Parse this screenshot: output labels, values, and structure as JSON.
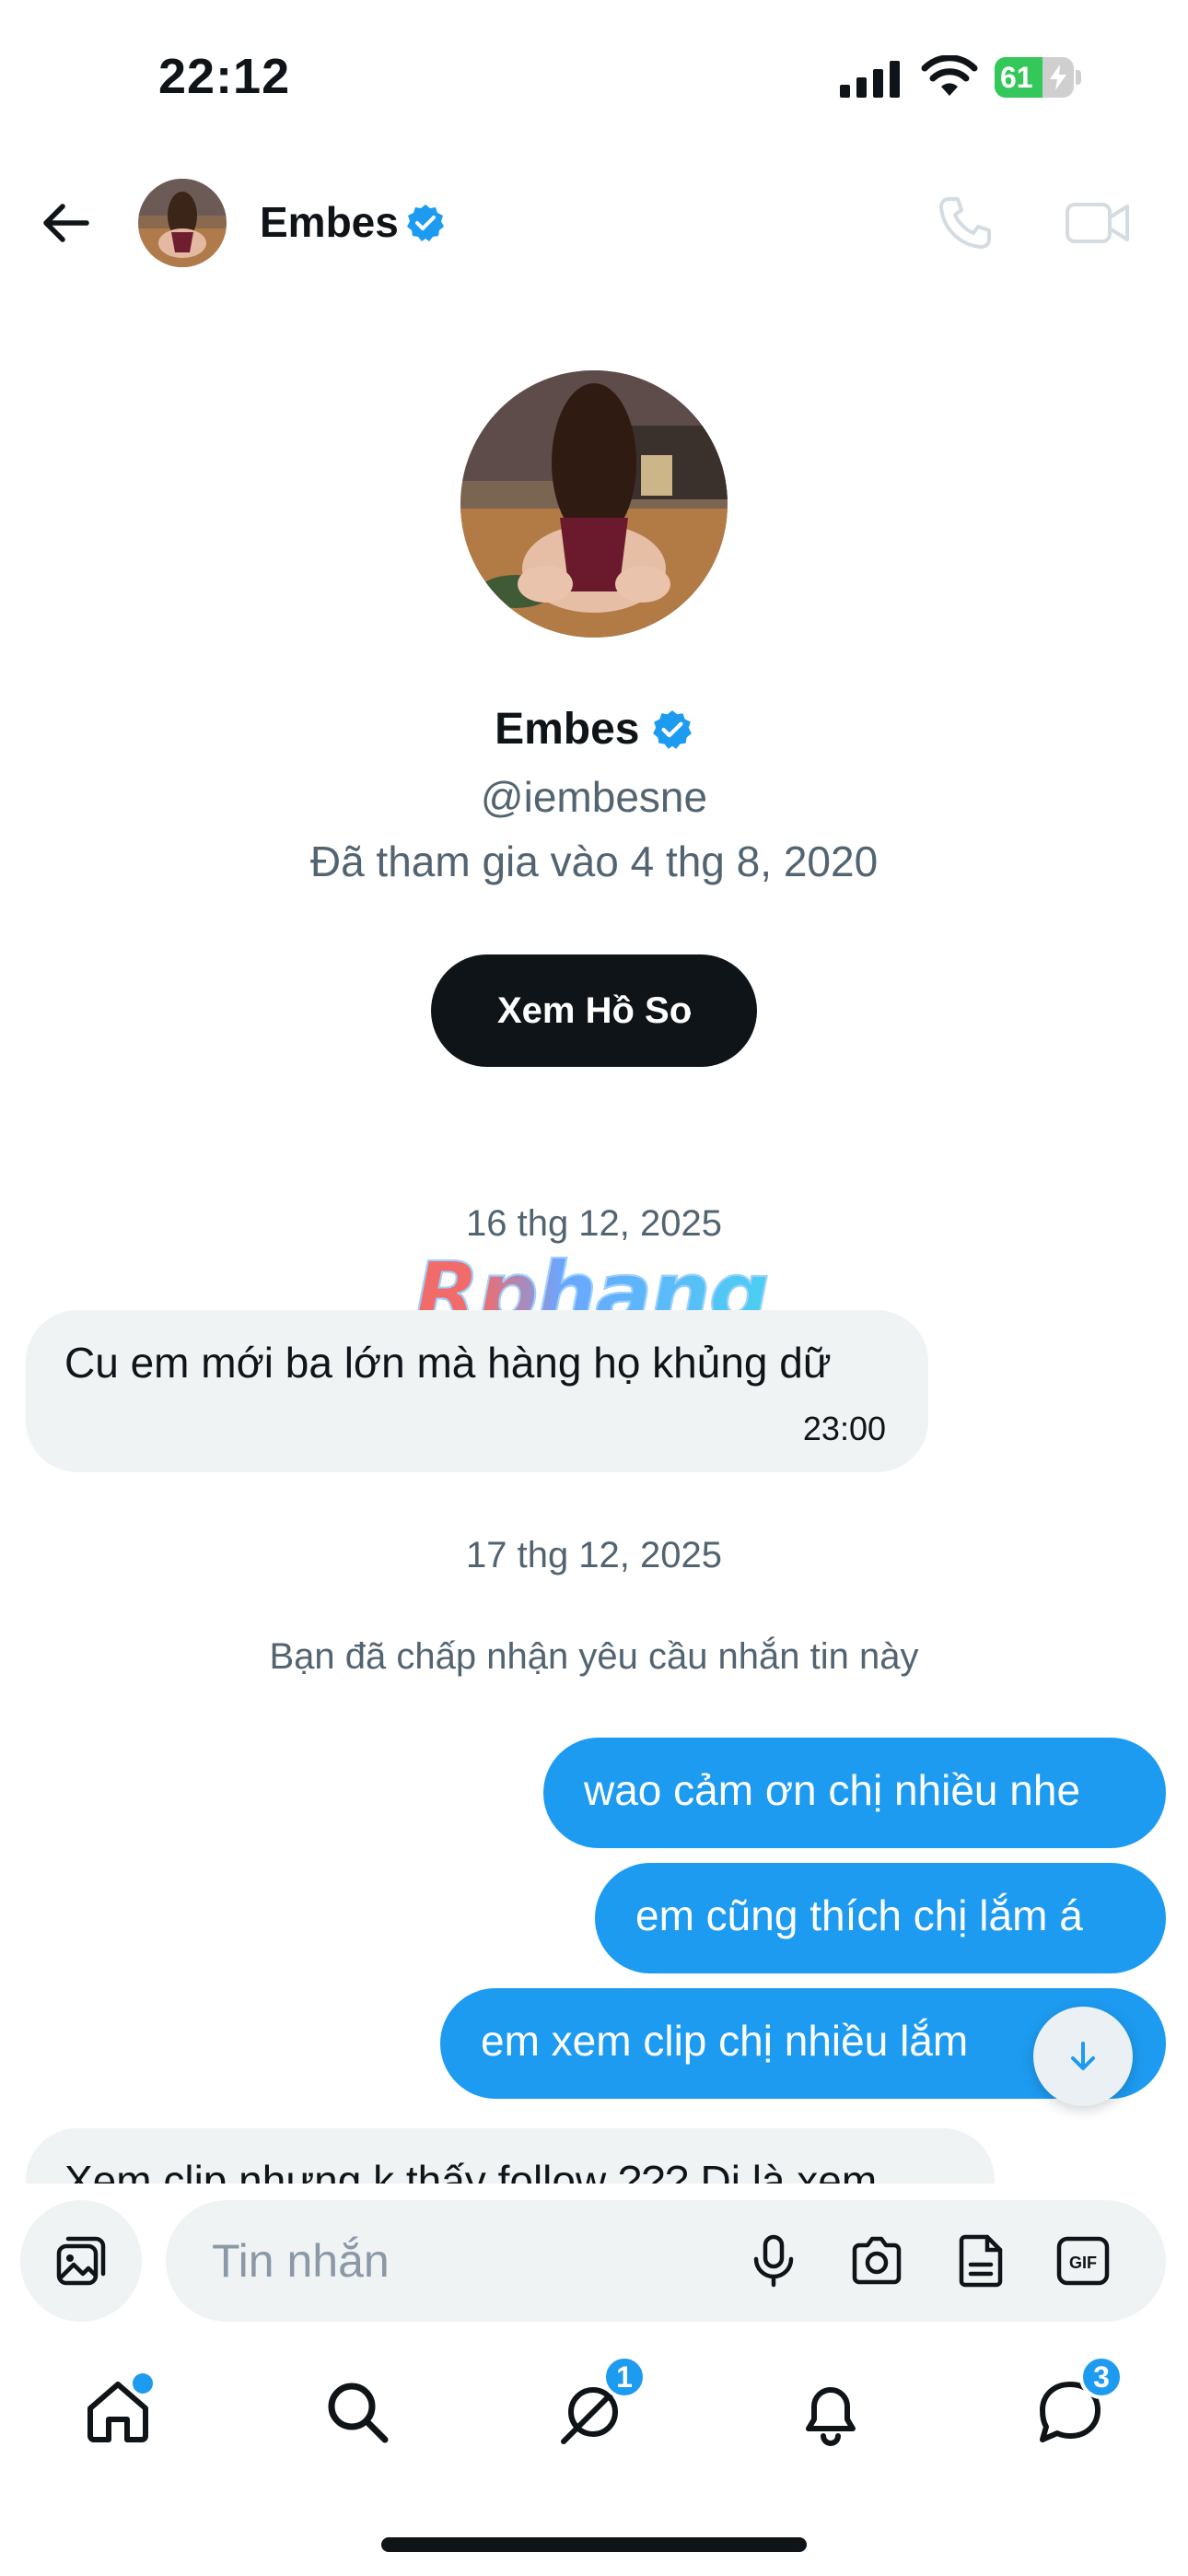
{
  "status_bar": {
    "time": "22:12",
    "battery_percent": "61",
    "battery_level": 0.61
  },
  "header": {
    "name": "Embes"
  },
  "profile": {
    "name": "Embes",
    "handle": "@iembesne",
    "joined": "Đã tham gia vào 4 thg 8, 2020",
    "view_profile_label": "Xem Hồ Sơ"
  },
  "watermark": "Rphang",
  "conversation": {
    "date_1": "16 thg 12, 2025",
    "incoming_1": {
      "text": "Cu em mới ba lớn mà hàng họ khủng dữ",
      "time": "23:00"
    },
    "date_2": "17 thg 12, 2025",
    "system_note": "Bạn đã chấp nhận yêu cầu nhắn tin này",
    "outgoing": [
      "wao cảm ơn chị nhiều nhe",
      "em cũng thích chị lắm á",
      "em xem clip chị nhiều lắm"
    ],
    "incoming_2": {
      "text": "Xem clip nhưng k thấy follow ??? Dị là xem"
    }
  },
  "composer": {
    "placeholder": "Tin nhắn"
  },
  "tab_bar": {
    "messages_badge": "1",
    "chat_badge": "3"
  },
  "colors": {
    "accent": "#1d9bf0",
    "text": "#0f1419",
    "muted": "#536471",
    "bubble_in": "#eff3f4"
  }
}
